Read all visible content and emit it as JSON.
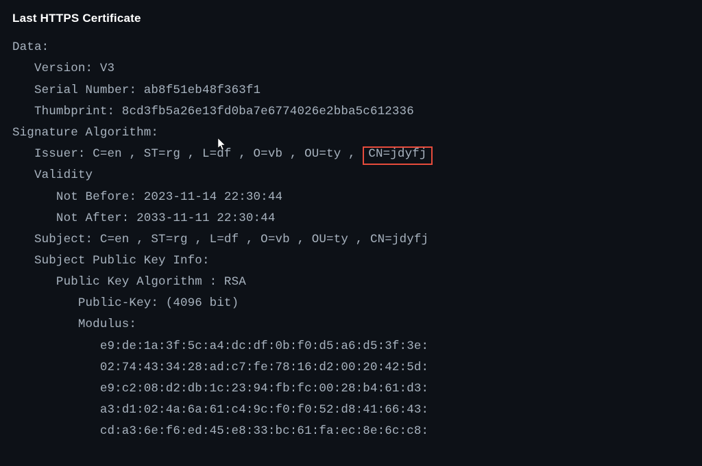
{
  "title": "Last HTTPS Certificate",
  "data_label": "Data:",
  "version_label": "Version:",
  "version_value": "V3",
  "serial_label": "Serial Number:",
  "serial_value": "ab8f51eb48f363f1",
  "thumbprint_label": "Thumbprint:",
  "thumbprint_value": "8cd3fb5a26e13fd0ba7e6774026e2bba5c612336",
  "sig_algo_label": "Signature Algorithm:",
  "issuer_label": "Issuer:",
  "issuer_prefix": "C=en , ST=rg , L=df , O=vb , OU=ty ,",
  "issuer_cn_boxed": "CN=jdyfj",
  "validity_label": "Validity",
  "not_before_label": "Not Before:",
  "not_before_value": "2023-11-14 22:30:44",
  "not_after_label": "Not After:",
  "not_after_value": "2033-11-11 22:30:44",
  "subject_label": "Subject:",
  "subject_value": "C=en , ST=rg , L=df , O=vb , OU=ty , CN=jdyfj",
  "spki_label": "Subject Public Key Info:",
  "pk_algo_label": "Public Key Algorithm :",
  "pk_algo_value": "RSA",
  "pk_bits_label": "Public-Key:",
  "pk_bits_value": "(4096 bit)",
  "modulus_label": "Modulus:",
  "modulus_lines": {
    "l0": "e9:de:1a:3f:5c:a4:dc:df:0b:f0:d5:a6:d5:3f:3e:",
    "l1": "02:74:43:34:28:ad:c7:fe:78:16:d2:00:20:42:5d:",
    "l2": "e9:c2:08:d2:db:1c:23:94:fb:fc:00:28:b4:61:d3:",
    "l3": "a3:d1:02:4a:6a:61:c4:9c:f0:f0:52:d8:41:66:43:",
    "l4": "cd:a3:6e:f6:ed:45:e8:33:bc:61:fa:ec:8e:6c:c8:"
  }
}
